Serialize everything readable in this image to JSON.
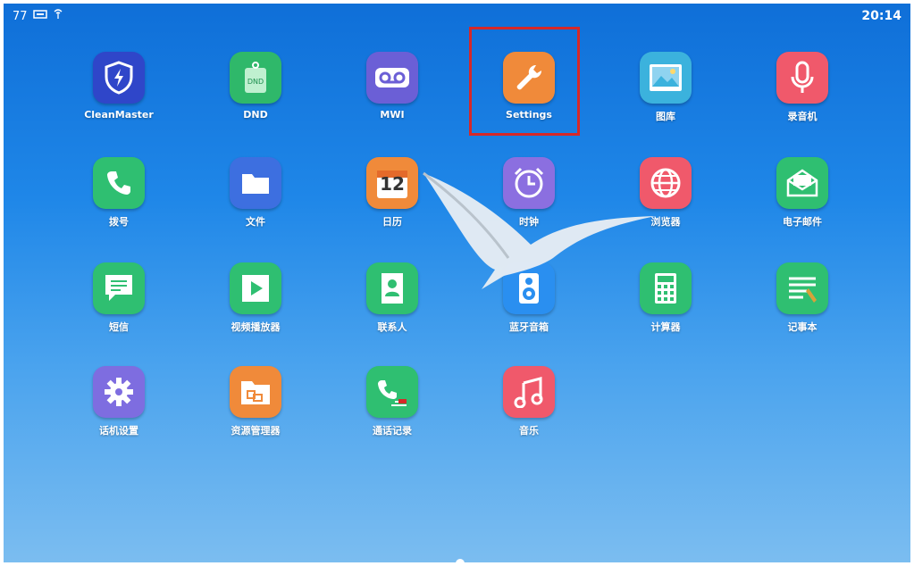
{
  "status": {
    "signal_text": "77",
    "time": "20:14"
  },
  "apps": [
    {
      "label": "CleanMaster",
      "icon": "shield-icon",
      "color": "#2f46c9"
    },
    {
      "label": "DND",
      "icon": "tag-icon",
      "color": "#2fb86a"
    },
    {
      "label": "MWI",
      "icon": "voicemail-icon",
      "color": "#6b5fd6"
    },
    {
      "label": "Settings",
      "icon": "wrench-icon",
      "color": "#f08a3a"
    },
    {
      "label": "图库",
      "icon": "gallery-icon",
      "color": "#3bb2dd"
    },
    {
      "label": "录音机",
      "icon": "microphone-icon",
      "color": "#f0596b"
    },
    {
      "label": "拨号",
      "icon": "phone-icon",
      "color": "#2fbf71"
    },
    {
      "label": "文件",
      "icon": "folder-icon",
      "color": "#3d6fe0"
    },
    {
      "label": "日历",
      "icon": "calendar-icon",
      "color": "#f08a3a",
      "calendar_day": "12"
    },
    {
      "label": "时钟",
      "icon": "alarm-clock-icon",
      "color": "#8b6fe0"
    },
    {
      "label": "浏览器",
      "icon": "globe-icon",
      "color": "#f0596b"
    },
    {
      "label": "电子邮件",
      "icon": "mail-icon",
      "color": "#2fbf71"
    },
    {
      "label": "短信",
      "icon": "message-icon",
      "color": "#2fbf71"
    },
    {
      "label": "视频播放器",
      "icon": "play-icon",
      "color": "#2fbf71"
    },
    {
      "label": "联系人",
      "icon": "contacts-icon",
      "color": "#2fbf71"
    },
    {
      "label": "蓝牙音箱",
      "icon": "speaker-icon",
      "color": "#2a8ff0"
    },
    {
      "label": "计算器",
      "icon": "calculator-icon",
      "color": "#2fbf71"
    },
    {
      "label": "记事本",
      "icon": "notepad-icon",
      "color": "#2fbf71"
    },
    {
      "label": "话机设置",
      "icon": "gear-icon",
      "color": "#7e6de0"
    },
    {
      "label": "资源管理器",
      "icon": "file-manager-icon",
      "color": "#f08a3a"
    },
    {
      "label": "通话记录",
      "icon": "call-log-icon",
      "color": "#2fbf71"
    },
    {
      "label": "音乐",
      "icon": "music-icon",
      "color": "#f0596b"
    }
  ]
}
